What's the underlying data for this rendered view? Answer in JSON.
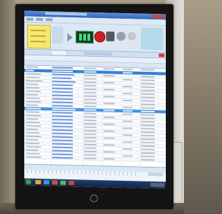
{
  "scene": {
    "description_free": true
  },
  "colors": {
    "titlebar": "#2f66b8",
    "accent_yellow": "#f7e96b",
    "counter_green": "#5af08a",
    "stop_red": "#d11f1f",
    "selection_blue": "#2f7fd6",
    "taskbar": "#0f2446"
  },
  "icons": {
    "stop": "stop-icon",
    "forward": "arrow-right-icon",
    "start": "windows-start-icon",
    "monitor_brand": "monitor-logo-icon"
  }
}
